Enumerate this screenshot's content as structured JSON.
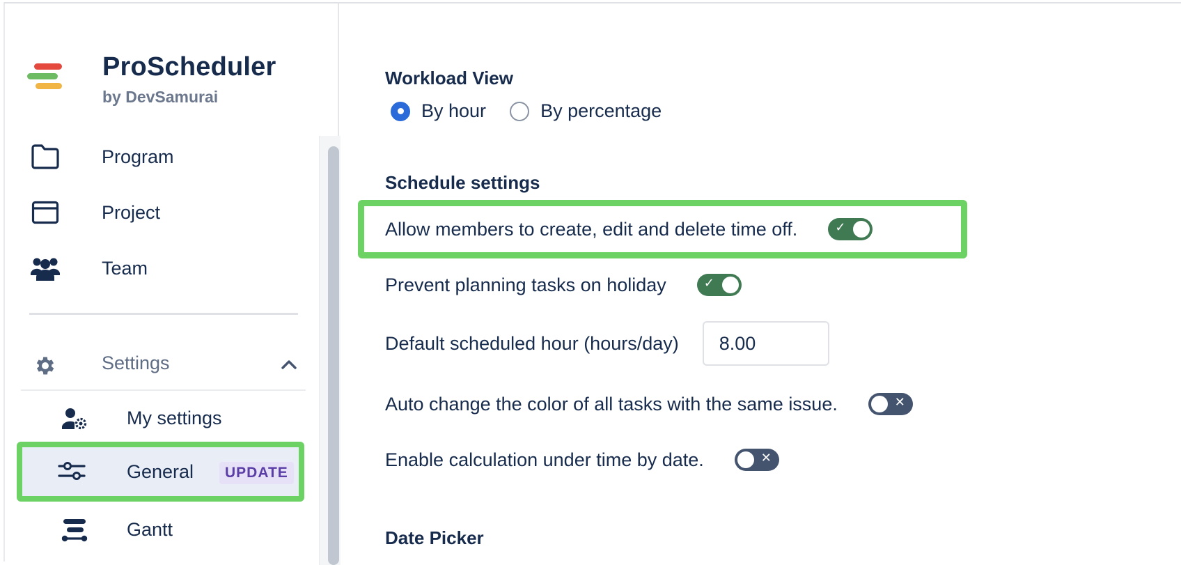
{
  "brand": {
    "title": "ProScheduler",
    "subtitle": "by DevSamurai",
    "logo_colors": [
      "#e5483d",
      "#6dbb63",
      "#f0b545"
    ]
  },
  "sidebar": {
    "items": [
      {
        "label": "Program",
        "icon": "folder-icon"
      },
      {
        "label": "Project",
        "icon": "window-icon"
      },
      {
        "label": "Team",
        "icon": "team-icon"
      }
    ],
    "settings": {
      "label": "Settings",
      "icon": "gear-icon",
      "expanded": true
    },
    "sub_items": [
      {
        "label": "My settings",
        "icon": "user-settings-icon"
      },
      {
        "label": "General",
        "icon": "sliders-icon",
        "badge": "UPDATE",
        "selected": true
      },
      {
        "label": "Gantt",
        "icon": "gantt-icon"
      }
    ]
  },
  "main": {
    "workload": {
      "title": "Workload View",
      "options": [
        {
          "label": "By hour",
          "checked": true
        },
        {
          "label": "By percentage",
          "checked": false
        }
      ]
    },
    "schedule": {
      "title": "Schedule settings",
      "allow_time_off": {
        "label": "Allow members to create, edit and delete time off.",
        "on": true
      },
      "prevent_holiday": {
        "label": "Prevent planning tasks on holiday",
        "on": true
      },
      "default_hours": {
        "label": "Default scheduled hour (hours/day)",
        "value": "8.00"
      },
      "auto_color": {
        "label": "Auto change the color of all tasks with the same issue.",
        "on": false
      },
      "under_time": {
        "label": "Enable calculation under time by date.",
        "on": false
      }
    },
    "date_picker": {
      "title": "Date Picker"
    }
  },
  "colors": {
    "accent": "#2b6bd9",
    "toggle_on": "#3f7a52",
    "toggle_off": "#44546f",
    "highlight": "#6dd264",
    "badge_bg": "#e7e1f8",
    "badge_text": "#5a3ea6"
  }
}
